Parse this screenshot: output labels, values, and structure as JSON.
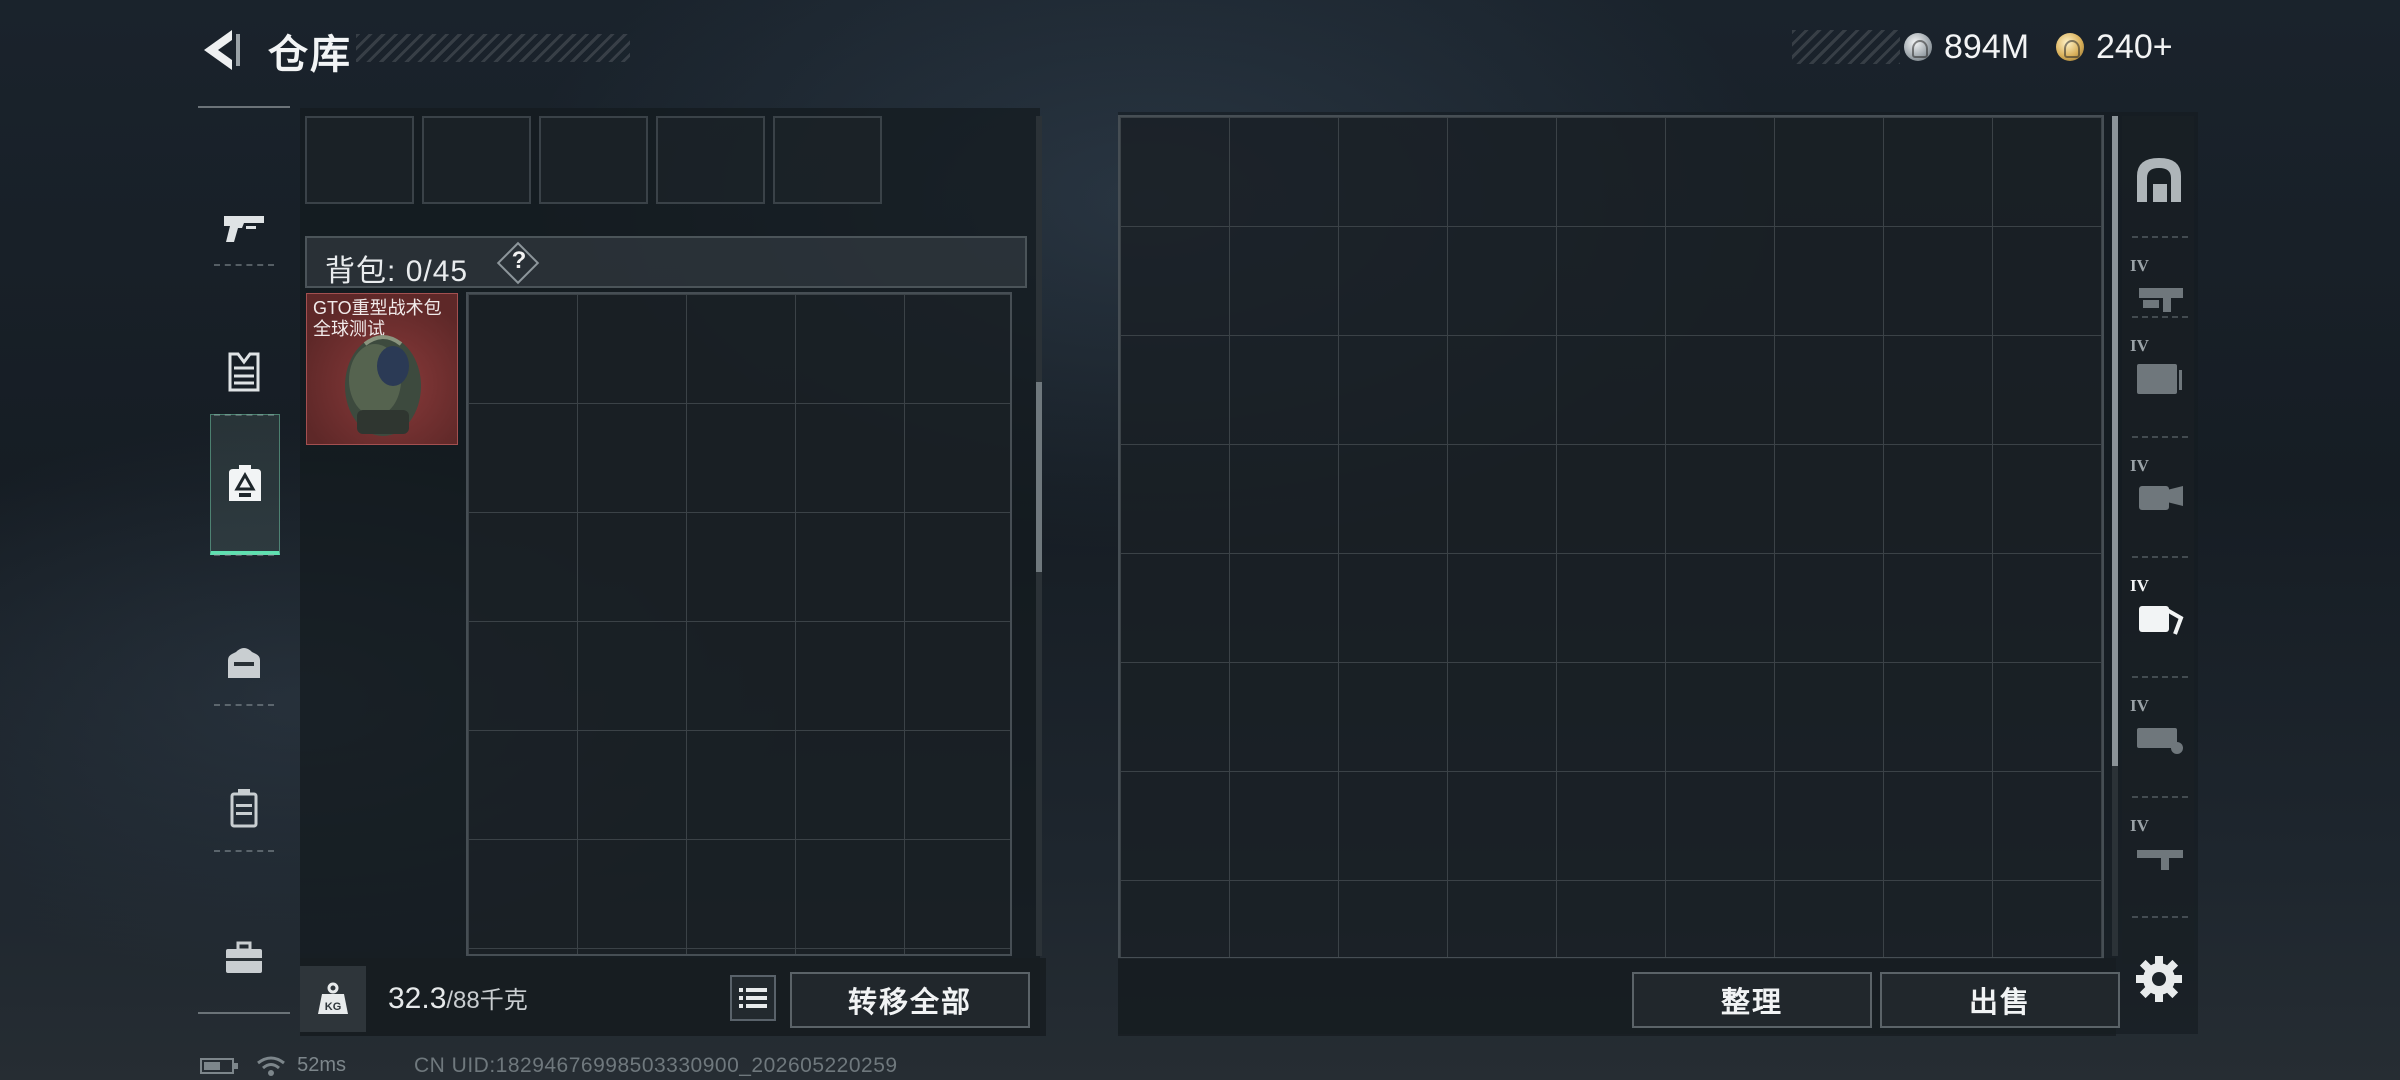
{
  "header": {
    "title": "仓库",
    "back_icon": "back-arrow-icon",
    "currencies": [
      {
        "icon": "silver-coin-icon",
        "value": "894M"
      },
      {
        "icon": "gold-coin-icon",
        "value": "240+"
      }
    ]
  },
  "sidebar": {
    "items": [
      {
        "icon": "pistol-icon",
        "active": false
      },
      {
        "icon": "vest-icon",
        "active": false
      },
      {
        "icon": "backpack-icon",
        "active": true
      },
      {
        "icon": "pouch-icon",
        "active": false
      },
      {
        "icon": "case-icon",
        "active": false
      },
      {
        "icon": "toolbox-icon",
        "active": false
      }
    ]
  },
  "backpack": {
    "label": "背包:",
    "capacity": "0/45",
    "help": "?",
    "item": {
      "name": "GTO重型战术包 全球测试",
      "color": "#6a2c2c"
    }
  },
  "weight": {
    "current": "32.3",
    "max": "/88千克",
    "icon": "kg-weight-icon"
  },
  "buttons": {
    "transfer_all": "转移全部",
    "organize": "整理",
    "sell": "出售"
  },
  "stash_tabs": [
    {
      "icon": "stash-home-icon",
      "tier": ""
    },
    {
      "icon": "stash-tab-1-icon",
      "tier": "IV"
    },
    {
      "icon": "stash-tab-2-icon",
      "tier": "IV"
    },
    {
      "icon": "stash-tab-3-icon",
      "tier": "IV"
    },
    {
      "icon": "stash-tab-4-icon",
      "tier": "IV",
      "active": true
    },
    {
      "icon": "stash-tab-5-icon",
      "tier": "IV"
    },
    {
      "icon": "stash-tab-6-icon",
      "tier": "IV"
    }
  ],
  "status": {
    "ping": "52ms",
    "uid": "CN UID:18294676998503330900_202605220259"
  },
  "colors": {
    "accent": "#5fe0b0",
    "item_bg": "#6a2c2c"
  }
}
